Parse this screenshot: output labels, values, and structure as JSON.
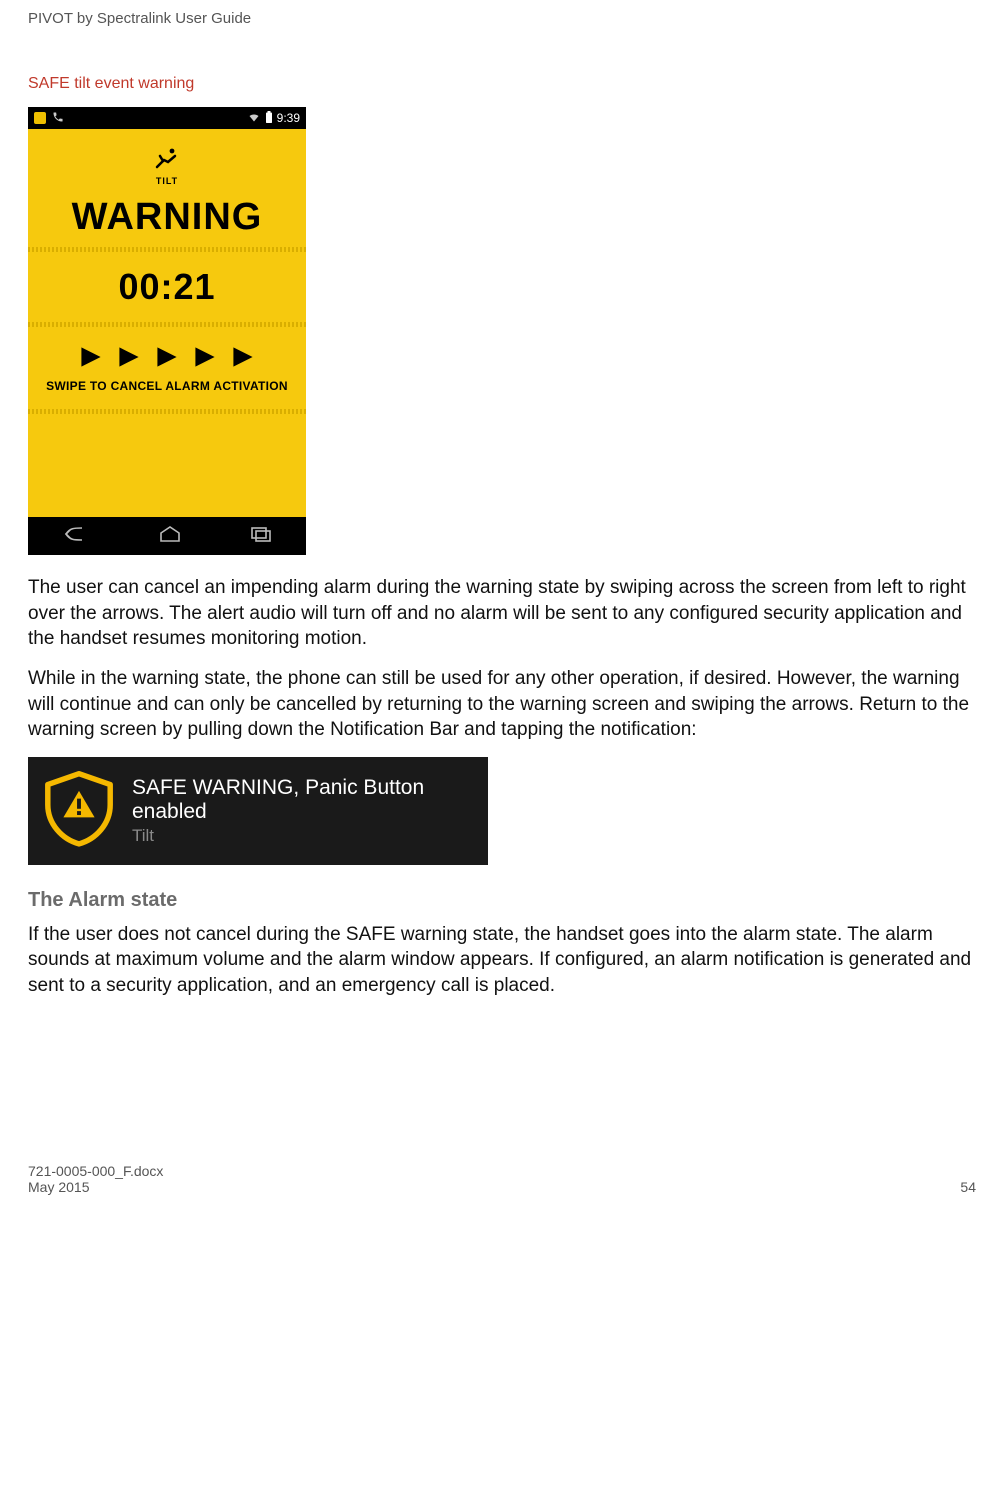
{
  "doc_header": "PIVOT by Spectralink User Guide",
  "caption": "SAFE tilt event warning",
  "phone": {
    "status_time": "9:39",
    "tilt_label": "TILT",
    "warning": "WARNING",
    "timer": "00:21",
    "swipe_text": "SWIPE TO CANCEL ALARM ACTIVATION"
  },
  "para1": "The user can cancel an impending alarm during the warning state by swiping across the screen from left to right over the arrows. The alert audio will turn off and no alarm will be sent to any configured security application and the handset resumes monitoring motion.",
  "para2": "While in the warning state, the phone can still be used for any other operation, if desired. However, the warning will continue and can only be cancelled by returning to the warning screen and swiping the arrows. Return to the warning screen by pulling down the Notification Bar and tapping the notification:",
  "notif": {
    "title": "SAFE WARNING, Panic Button enabled",
    "sub": "Tilt"
  },
  "section_heading": "The Alarm state",
  "para3": "If the user does not cancel during the SAFE warning state, the handset goes into the alarm state. The alarm sounds at maximum volume and the alarm window appears. If configured, an alarm notification is generated and sent to a security application, and an emergency call is placed.",
  "footer": {
    "doc_file": "721-0005-000_F.docx",
    "date": "May 2015",
    "page": "54"
  }
}
